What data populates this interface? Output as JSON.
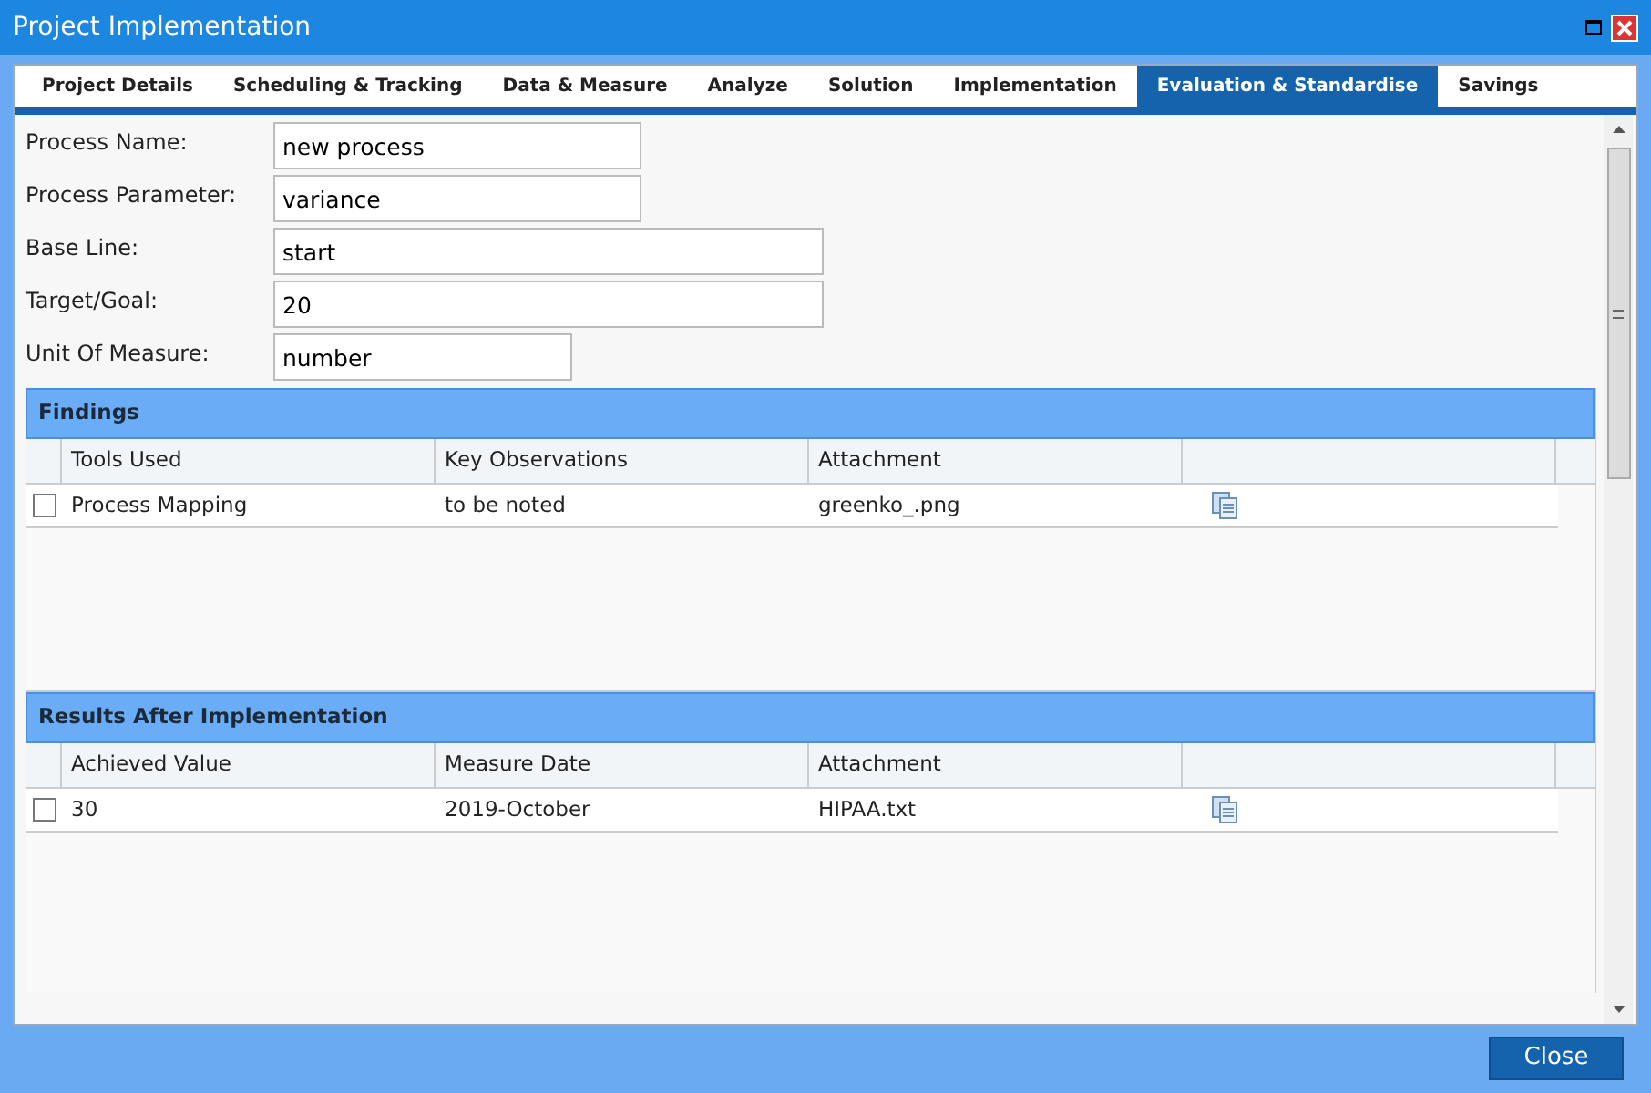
{
  "window": {
    "title": "Project Implementation"
  },
  "tabs": [
    {
      "label": "Project Details",
      "selected": false
    },
    {
      "label": "Scheduling & Tracking",
      "selected": false
    },
    {
      "label": "Data & Measure",
      "selected": false
    },
    {
      "label": "Analyze",
      "selected": false
    },
    {
      "label": "Solution",
      "selected": false
    },
    {
      "label": "Implementation",
      "selected": false
    },
    {
      "label": "Evaluation & Standardise",
      "selected": true
    },
    {
      "label": "Savings",
      "selected": false
    }
  ],
  "fields": [
    {
      "label": "Process Name:",
      "value": "new process",
      "kind": "short"
    },
    {
      "label": "Process Parameter:",
      "value": "variance",
      "kind": "short"
    },
    {
      "label": "Base Line:",
      "value": "start",
      "kind": "long"
    },
    {
      "label": "Target/Goal:",
      "value": "20",
      "kind": "long"
    },
    {
      "label": "Unit Of Measure:",
      "value": "number",
      "kind": "small"
    }
  ],
  "grids": [
    {
      "title": "Findings",
      "columns": [
        "Tools Used",
        "Key Observations",
        "Attachment"
      ],
      "rows": [
        {
          "checked": false,
          "cells": [
            "Process Mapping",
            "to be noted",
            "greenko_.png"
          ]
        }
      ]
    },
    {
      "title": "Results After Implementation",
      "columns": [
        "Achieved Value",
        "Measure Date",
        "Attachment"
      ],
      "rows": [
        {
          "checked": false,
          "cells": [
            "30",
            "2019-October",
            "HIPAA.txt"
          ]
        }
      ]
    }
  ],
  "buttons": [
    "Close"
  ]
}
